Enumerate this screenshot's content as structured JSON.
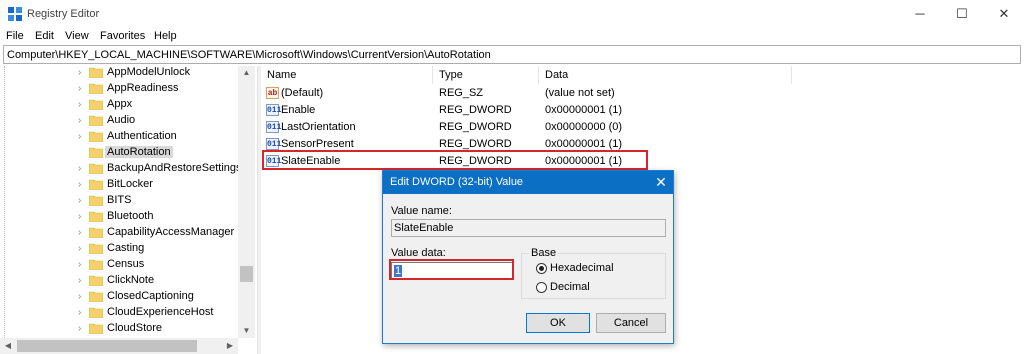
{
  "window": {
    "title": "Registry Editor",
    "minimize_glyph": "─",
    "maximize_glyph": "☐",
    "close_glyph": "✕"
  },
  "menu": [
    "File",
    "Edit",
    "View",
    "Favorites",
    "Help"
  ],
  "address": "Computer\\HKEY_LOCAL_MACHINE\\SOFTWARE\\Microsoft\\Windows\\CurrentVersion\\AutoRotation",
  "tree": {
    "items": [
      {
        "label": "AppModelUnlock",
        "expandable": true
      },
      {
        "label": "AppReadiness",
        "expandable": true
      },
      {
        "label": "Appx",
        "expandable": true
      },
      {
        "label": "Audio",
        "expandable": true
      },
      {
        "label": "Authentication",
        "expandable": true
      },
      {
        "label": "AutoRotation",
        "expandable": false,
        "selected": true
      },
      {
        "label": "BackupAndRestoreSettings",
        "expandable": true
      },
      {
        "label": "BitLocker",
        "expandable": true
      },
      {
        "label": "BITS",
        "expandable": true
      },
      {
        "label": "Bluetooth",
        "expandable": true
      },
      {
        "label": "CapabilityAccessManager",
        "expandable": true
      },
      {
        "label": "Casting",
        "expandable": true
      },
      {
        "label": "Census",
        "expandable": true
      },
      {
        "label": "ClickNote",
        "expandable": true
      },
      {
        "label": "ClosedCaptioning",
        "expandable": true
      },
      {
        "label": "CloudExperienceHost",
        "expandable": true
      },
      {
        "label": "CloudStore",
        "expandable": true
      }
    ],
    "expand_glyph": "›",
    "scroll_up_glyph": "▲",
    "scroll_down_glyph": "▼",
    "scroll_left_glyph": "◀",
    "scroll_right_glyph": "▶"
  },
  "values": {
    "columns": {
      "name": "Name",
      "type": "Type",
      "data": "Data"
    },
    "rows": [
      {
        "icon": "string-value-icon",
        "icon_text": "ab",
        "name": "(Default)",
        "type": "REG_SZ",
        "data": "(value not set)"
      },
      {
        "icon": "binary-value-icon",
        "icon_text": "011",
        "name": "Enable",
        "type": "REG_DWORD",
        "data": "0x00000001 (1)"
      },
      {
        "icon": "binary-value-icon",
        "icon_text": "011",
        "name": "LastOrientation",
        "type": "REG_DWORD",
        "data": "0x00000000 (0)"
      },
      {
        "icon": "binary-value-icon",
        "icon_text": "011",
        "name": "SensorPresent",
        "type": "REG_DWORD",
        "data": "0x00000001 (1)"
      },
      {
        "icon": "binary-value-icon",
        "icon_text": "011",
        "name": "SlateEnable",
        "type": "REG_DWORD",
        "data": "0x00000001 (1)"
      }
    ]
  },
  "dialog": {
    "title": "Edit DWORD (32-bit) Value",
    "close_glyph": "✕",
    "value_name_label": "Value name:",
    "value_name": "SlateEnable",
    "value_data_label": "Value data:",
    "value_data": "1",
    "base_label": "Base",
    "hex_label": "Hexadecimal",
    "dec_label": "Decimal",
    "base_selected": "hexadecimal",
    "ok_label": "OK",
    "cancel_label": "Cancel"
  },
  "colors": {
    "highlight_border": "#d6262c",
    "dialog_title": "#0b6fc3",
    "folder": "#f4d26b"
  }
}
